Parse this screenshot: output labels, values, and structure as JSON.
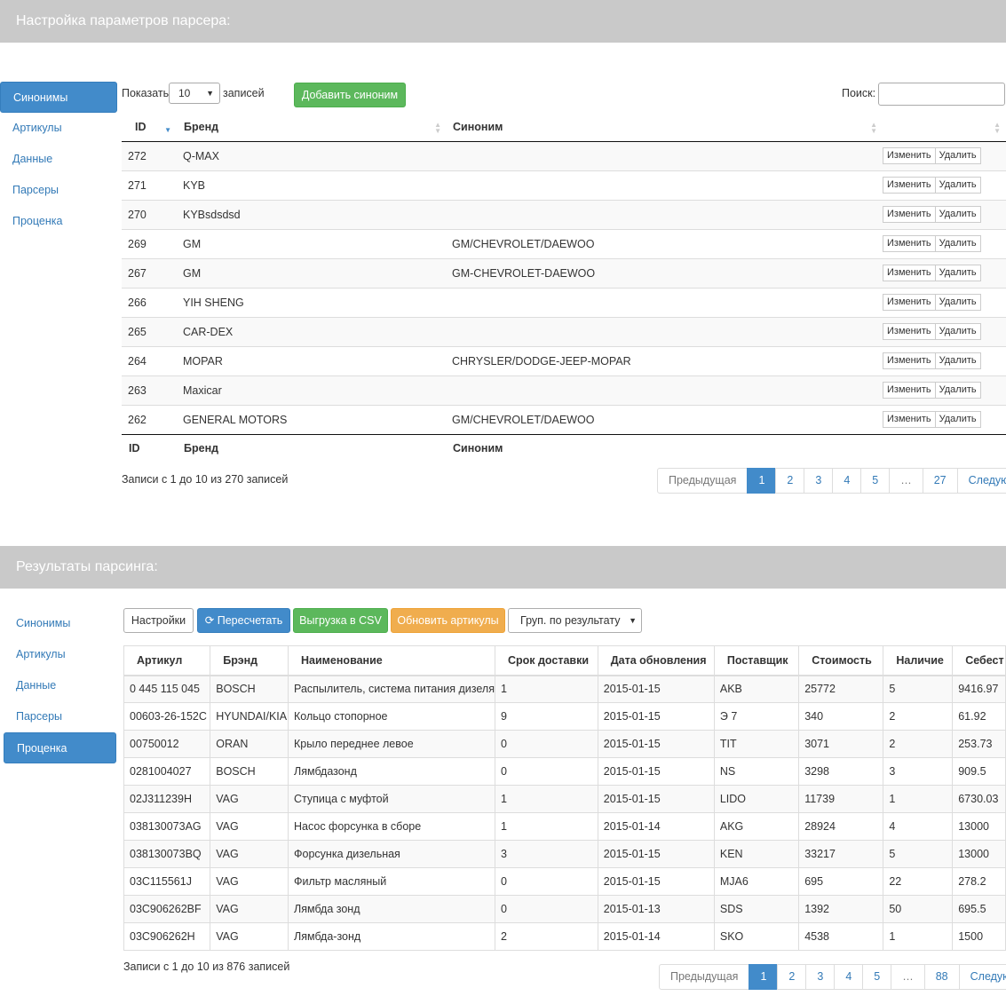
{
  "panel1": {
    "title": "Настройка параметров парсера:"
  },
  "panel2": {
    "title": "Результаты парсинга:"
  },
  "sidebar1": {
    "items": [
      "Синонимы",
      "Артикулы",
      "Данные",
      "Парсеры",
      "Проценка"
    ]
  },
  "sidebar2": {
    "items": [
      "Синонимы",
      "Артикулы",
      "Данные",
      "Парсеры",
      "Проценка"
    ]
  },
  "synonyms": {
    "show_label": "Показать",
    "show_value": "10",
    "records_label": "записей",
    "add_button": "Добавить синоним",
    "search_label": "Поиск:",
    "search_value": "",
    "columns": [
      "ID",
      "Бренд",
      "Синоним"
    ],
    "rows": [
      {
        "id": "272",
        "brand": "Q-MAX",
        "syn": ""
      },
      {
        "id": "271",
        "brand": "KYB",
        "syn": ""
      },
      {
        "id": "270",
        "brand": "KYBsdsdsd",
        "syn": ""
      },
      {
        "id": "269",
        "brand": "GM",
        "syn": "GM/CHEVROLET/DAEWOO"
      },
      {
        "id": "267",
        "brand": "GM",
        "syn": "GM-CHEVROLET-DAEWOO"
      },
      {
        "id": "266",
        "brand": "YIH SHENG",
        "syn": ""
      },
      {
        "id": "265",
        "brand": "CAR-DEX",
        "syn": ""
      },
      {
        "id": "264",
        "brand": "MOPAR",
        "syn": "CHRYSLER/DODGE-JEEP-MOPAR"
      },
      {
        "id": "263",
        "brand": "Maxicar",
        "syn": ""
      },
      {
        "id": "262",
        "brand": "GENERAL MOTORS",
        "syn": "GM/CHEVROLET/DAEWOO"
      }
    ],
    "edit_label": "Изменить",
    "delete_label": "Удалить",
    "info": "Записи с 1 до 10 из 270 записей",
    "pager": [
      "Предыдущая",
      "1",
      "2",
      "3",
      "4",
      "5",
      "…",
      "27",
      "Следующая"
    ]
  },
  "results": {
    "toolbar": {
      "settings": "Настройки",
      "recalc": "Пересчетать",
      "export_csv": "Выгрузка в CSV",
      "update": "Обновить артикулы",
      "group": "Груп. по результату"
    },
    "columns": [
      "Артикул",
      "Брэнд",
      "Наименование",
      "Срок доставки",
      "Дата обновления",
      "Поставщик",
      "Стоимость",
      "Наличие",
      "Себест"
    ],
    "rows": [
      [
        "0 445 115 045",
        "BOSCH",
        "Распылитель, система питания дизеля",
        "1",
        "2015-01-15",
        "AKB",
        "25772",
        "5",
        "9416.97"
      ],
      [
        "00603-26-152C",
        "HYUNDAI/KIA",
        "Кольцо стопорное",
        "9",
        "2015-01-15",
        "Э 7",
        "340",
        "2",
        "61.92"
      ],
      [
        "00750012",
        "ORAN",
        "Крыло переднее левое",
        "0",
        "2015-01-15",
        "TIT",
        "3071",
        "2",
        "253.73"
      ],
      [
        "0281004027",
        "BOSCH",
        "Лямбдазонд",
        "0",
        "2015-01-15",
        "NS",
        "3298",
        "3",
        "909.5"
      ],
      [
        "02J311239H",
        "VAG",
        "Ступица с муфтой",
        "1",
        "2015-01-15",
        "LIDO",
        "11739",
        "1",
        "6730.03"
      ],
      [
        "038130073AG",
        "VAG",
        "Насос форсунка в сборе",
        "1",
        "2015-01-14",
        "AKG",
        "28924",
        "4",
        "13000"
      ],
      [
        "038130073BQ",
        "VAG",
        "Форсунка дизельная",
        "3",
        "2015-01-15",
        "KEN",
        "33217",
        "5",
        "13000"
      ],
      [
        "03C115561J",
        "VAG",
        "Фильтр масляный",
        "0",
        "2015-01-15",
        "MJA6",
        "695",
        "22",
        "278.2"
      ],
      [
        "03C906262BF",
        "VAG",
        "Лямбда зонд",
        "0",
        "2015-01-13",
        "SDS",
        "1392",
        "50",
        "695.5"
      ],
      [
        "03C906262H",
        "VAG",
        "Лямбда-зонд",
        "2",
        "2015-01-14",
        "SKO",
        "4538",
        "1",
        "1500"
      ]
    ],
    "info": "Записи с 1 до 10 из 876 записей",
    "pager": [
      "Предыдущая",
      "1",
      "2",
      "3",
      "4",
      "5",
      "…",
      "88",
      "Следующая"
    ]
  },
  "colors": {
    "primary": "#428bca",
    "success": "#5cb85c",
    "warning": "#f0ad4e",
    "header": "#c9c9c9"
  }
}
